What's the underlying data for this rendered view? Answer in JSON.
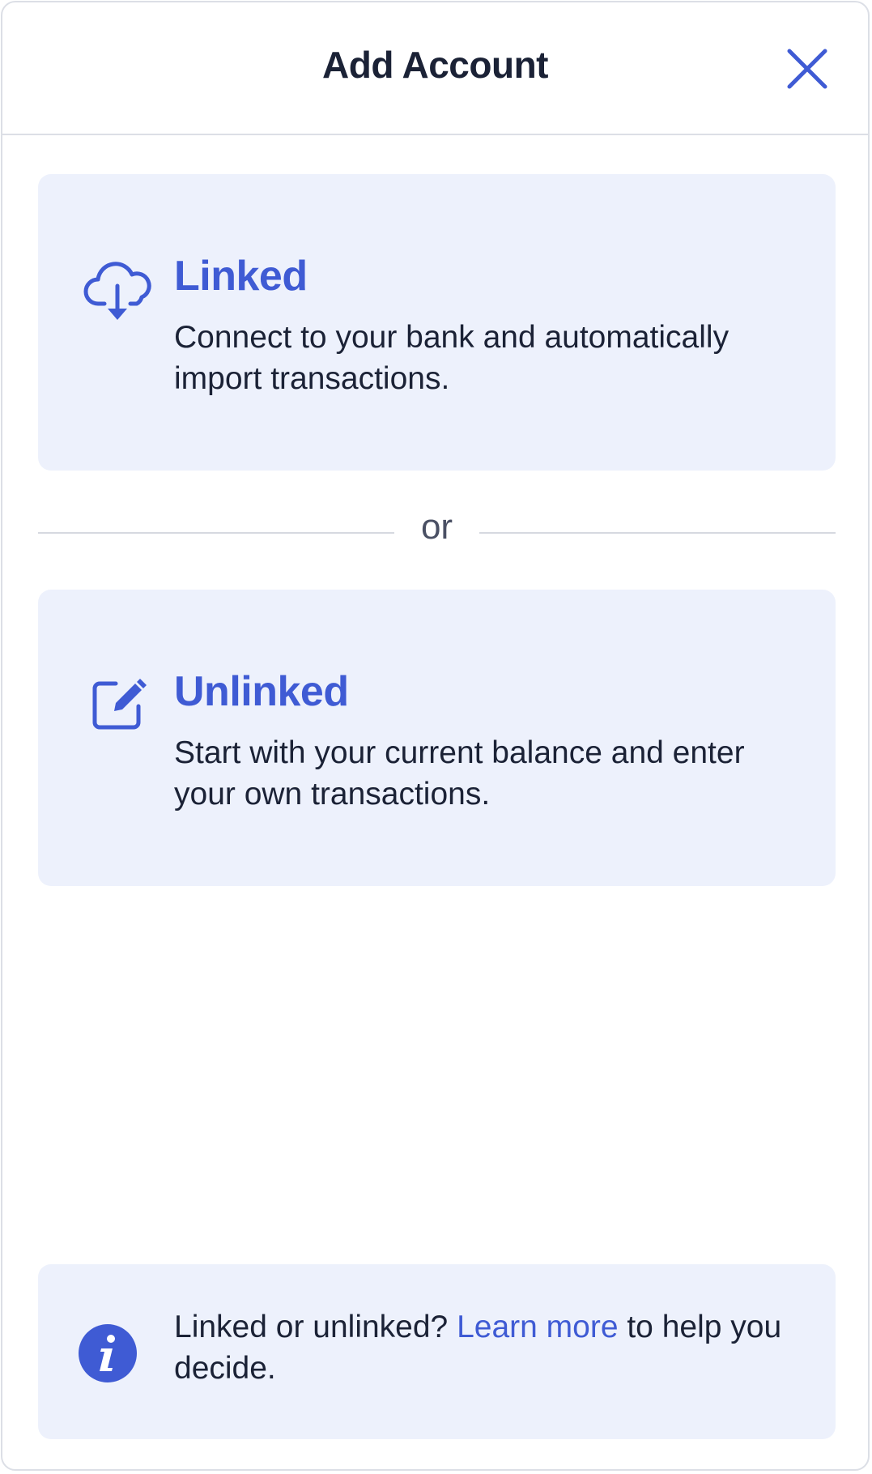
{
  "dialog": {
    "title": "Add Account"
  },
  "options": {
    "linked": {
      "title": "Linked",
      "description": "Connect to your bank and automatically import transactions.",
      "icon": "cloud-download-icon"
    },
    "divider": "or",
    "unlinked": {
      "title": "Unlinked",
      "description": "Start with your current balance and enter your own transactions.",
      "icon": "edit-icon"
    }
  },
  "info": {
    "icon": "info-icon",
    "text_before": "Linked or unlinked? ",
    "link_text": "Learn more",
    "text_after": " to help you decide."
  },
  "colors": {
    "accent": "#3f5bd4",
    "card_background": "#edf1fc",
    "text": "#1b2236",
    "border": "#dcdfe6"
  }
}
